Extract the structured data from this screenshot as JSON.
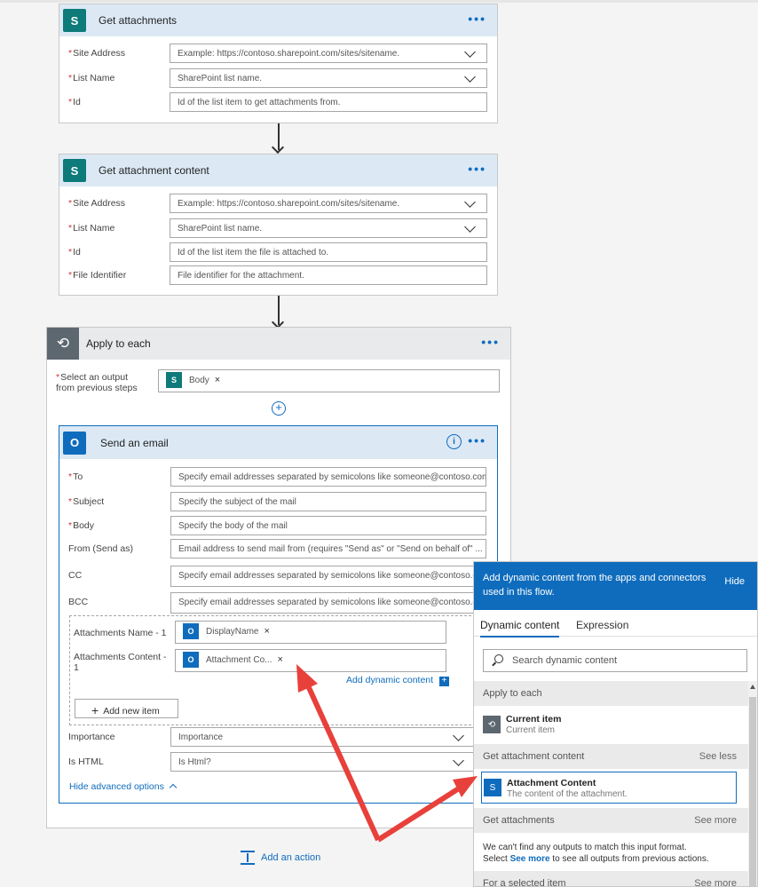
{
  "card1": {
    "title": "Get attachments",
    "fields": [
      {
        "label": "Site Address",
        "placeholder": "Example: https://contoso.sharepoint.com/sites/sitename."
      },
      {
        "label": "List Name",
        "placeholder": "SharePoint list name."
      },
      {
        "label": "Id",
        "placeholder": "Id of the list item to get attachments from."
      }
    ]
  },
  "card2": {
    "title": "Get attachment content",
    "fields": [
      {
        "label": "Site Address",
        "placeholder": "Example: https://contoso.sharepoint.com/sites/sitename."
      },
      {
        "label": "List Name",
        "placeholder": "SharePoint list name."
      },
      {
        "label": "Id",
        "placeholder": "Id of the list item the file is attached to."
      },
      {
        "label": "File Identifier",
        "placeholder": "File identifier for the attachment."
      }
    ]
  },
  "apply": {
    "title": "Apply to each",
    "select_label_1": "Select an output",
    "select_label_2": "from previous steps",
    "token": "Body"
  },
  "email": {
    "title": "Send an email",
    "fields": [
      {
        "label": "To",
        "placeholder": "Specify email addresses separated by semicolons like someone@contoso.com"
      },
      {
        "label": "Subject",
        "placeholder": "Specify the subject of the mail"
      },
      {
        "label": "Body",
        "placeholder": "Specify the body of the mail"
      },
      {
        "label": "From (Send as)",
        "placeholder": "Email address to send mail from (requires \"Send as\" or \"Send on behalf of\" ..."
      },
      {
        "label": "CC",
        "placeholder": "Specify email addresses separated by semicolons like someone@contoso.com"
      },
      {
        "label": "BCC",
        "placeholder": "Specify email addresses separated by semicolons like someone@contoso.com"
      }
    ],
    "attach_name_label": "Attachments Name - 1",
    "attach_name_token": "DisplayName",
    "attach_content_label_1": "Attachments Content -",
    "attach_content_label_2": "1",
    "attach_content_token": "Attachment Co...",
    "add_dynamic": "Add dynamic content",
    "add_new_item": "Add new item",
    "importance_label": "Importance",
    "importance_value": "Importance",
    "ishtml_label": "Is HTML",
    "ishtml_value": "Is Html?",
    "hide_advanced": "Hide advanced options"
  },
  "add_action": "Add an action",
  "panel": {
    "header_1": "Add dynamic content from the apps and connectors",
    "header_2": "used in this flow.",
    "hide": "Hide",
    "tab_dynamic": "Dynamic content",
    "tab_expression": "Expression",
    "search_placeholder": "Search dynamic content",
    "sec_apply": "Apply to each",
    "current_item_title": "Current item",
    "current_item_sub": "Current item",
    "sec_get_content": "Get attachment content",
    "see_less": "See less",
    "attach_content_title": "Attachment Content",
    "attach_content_sub": "The content of the attachment.",
    "sec_get_attachments": "Get attachments",
    "see_more": "See more",
    "msg_1": "We can't find any outputs to match this input format.",
    "msg_2a": "Select",
    "msg_2b": "See more",
    "msg_2c": "to see all outputs from previous actions.",
    "sec_selected": "For a selected item",
    "see_more_2": "See more"
  },
  "colors": {
    "accent": "#0f6cbd",
    "sharepoint": "#0e7a7a",
    "required": "#d13438",
    "annotation_arrow": "#e8403a"
  }
}
